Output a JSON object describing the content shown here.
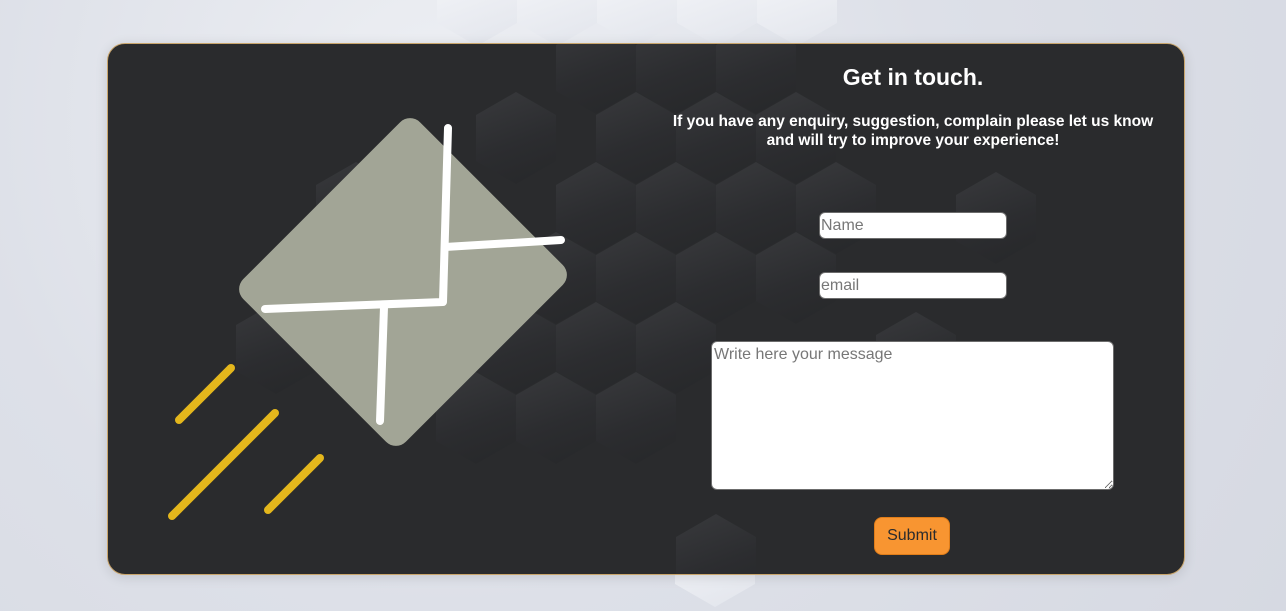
{
  "contact": {
    "title": "Get in touch.",
    "subtitle": "If you have any enquiry, suggestion, complain please let us know and will try to improve your experience!",
    "name_placeholder": "Name",
    "email_placeholder": "email",
    "message_placeholder": "Write here your message",
    "submit_label": "Submit"
  },
  "colors": {
    "card_background": "#2a2b2d",
    "card_border": "#c9a56b",
    "accent": "#f89531",
    "envelope": "#a2a596",
    "speed_lines": "#e4b71c",
    "page_background": "#dde0e8"
  },
  "icons": {
    "illustration": "flying-envelope-icon"
  }
}
